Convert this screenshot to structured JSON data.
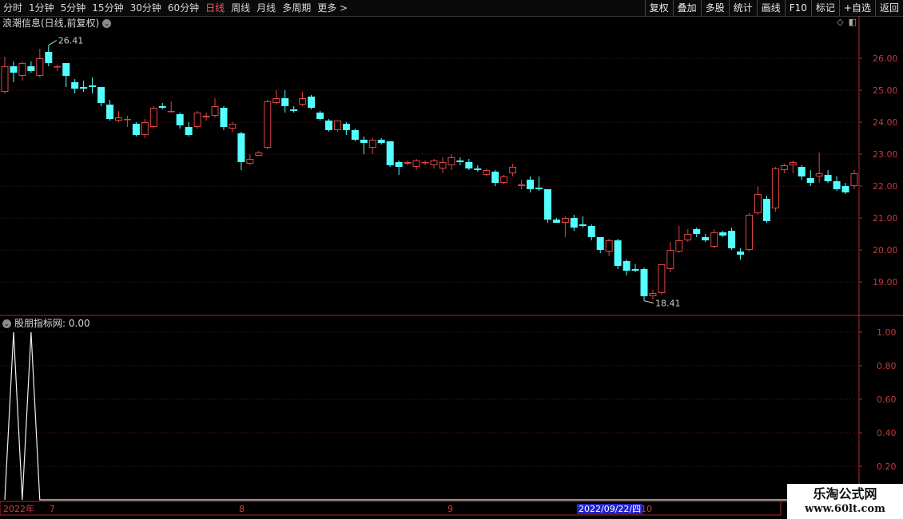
{
  "toolbar": {
    "tabs": [
      "分时",
      "1分钟",
      "5分钟",
      "15分钟",
      "30分钟",
      "60分钟",
      "日线",
      "周线",
      "月线",
      "多周期",
      "更多 >"
    ],
    "active_tab": "日线",
    "right_buttons": [
      "复权",
      "叠加",
      "多股",
      "统计",
      "画线",
      "F10",
      "标记",
      "+自选",
      "返回"
    ]
  },
  "main_panel": {
    "title": "浪潮信息(日线,前复权)",
    "max_label": "26.41",
    "min_label": "18.41",
    "price_ticks": [
      "26.00",
      "25.00",
      "24.00",
      "23.00",
      "22.00",
      "21.00",
      "20.00",
      "19.00"
    ],
    "up_color": "#e04545",
    "down_color": "#54ffff"
  },
  "indicator_panel": {
    "title": "股朋指标网",
    "value": ": 0.00",
    "ticks": [
      "1.00",
      "0.80",
      "0.60",
      "0.40",
      "0.20"
    ]
  },
  "date_axis": {
    "year_label": "2022年",
    "month_labels": [
      "7",
      "8",
      "9",
      "10"
    ],
    "cursor_date": "2022/09/22/四"
  },
  "watermark": {
    "line1": "乐淘公式网",
    "line2": "www.60lt.com"
  },
  "chart_data": {
    "type": "candlestick",
    "y_range": [
      18.0,
      26.9
    ],
    "candles": [
      [
        24.95,
        25.75,
        24.9,
        26.05
      ],
      [
        25.75,
        25.55,
        25.25,
        25.9
      ],
      [
        25.45,
        25.85,
        25.3,
        25.9
      ],
      [
        25.75,
        25.6,
        25.55,
        25.9
      ],
      [
        25.45,
        26.0,
        25.4,
        26.3
      ],
      [
        26.2,
        25.85,
        25.75,
        26.41
      ],
      [
        25.75,
        25.75,
        25.6,
        25.8
      ],
      [
        25.85,
        25.45,
        25.1,
        25.85
      ],
      [
        25.25,
        25.05,
        24.9,
        25.35
      ],
      [
        25.1,
        25.05,
        24.95,
        25.3
      ],
      [
        25.15,
        25.1,
        24.9,
        25.4
      ],
      [
        25.1,
        24.6,
        24.5,
        25.1
      ],
      [
        24.55,
        24.1,
        24.05,
        24.7
      ],
      [
        24.05,
        24.15,
        24.0,
        24.35
      ],
      [
        24.1,
        24.1,
        23.85,
        24.2
      ],
      [
        23.95,
        23.6,
        23.55,
        24.0
      ],
      [
        23.6,
        24.0,
        23.5,
        24.1
      ],
      [
        23.85,
        24.45,
        23.8,
        24.5
      ],
      [
        24.5,
        24.45,
        24.4,
        24.6
      ],
      [
        24.35,
        24.35,
        24.3,
        24.65
      ],
      [
        24.25,
        23.9,
        23.8,
        24.3
      ],
      [
        23.85,
        23.6,
        23.55,
        24.0
      ],
      [
        23.85,
        24.3,
        23.8,
        24.35
      ],
      [
        24.15,
        24.2,
        24.05,
        24.3
      ],
      [
        24.2,
        24.5,
        24.15,
        24.75
      ],
      [
        24.45,
        23.85,
        23.75,
        24.5
      ],
      [
        23.8,
        23.95,
        23.7,
        24.0
      ],
      [
        23.65,
        22.75,
        22.5,
        23.7
      ],
      [
        22.7,
        22.85,
        22.65,
        23.0
      ],
      [
        22.95,
        23.05,
        22.95,
        23.1
      ],
      [
        23.2,
        24.65,
        23.15,
        24.7
      ],
      [
        24.6,
        24.75,
        24.55,
        25.0
      ],
      [
        24.75,
        24.5,
        24.3,
        25.0
      ],
      [
        24.4,
        24.35,
        24.3,
        24.5
      ],
      [
        24.55,
        24.75,
        24.5,
        24.95
      ],
      [
        24.8,
        24.45,
        24.4,
        24.85
      ],
      [
        24.3,
        24.1,
        24.05,
        24.35
      ],
      [
        24.05,
        23.75,
        23.7,
        24.1
      ],
      [
        23.75,
        24.05,
        23.7,
        24.05
      ],
      [
        23.95,
        23.75,
        23.6,
        24.0
      ],
      [
        23.75,
        23.45,
        23.4,
        23.8
      ],
      [
        23.45,
        23.35,
        23.0,
        23.55
      ],
      [
        23.2,
        23.45,
        23.0,
        23.5
      ],
      [
        23.45,
        23.35,
        23.3,
        23.5
      ],
      [
        23.4,
        22.65,
        22.6,
        23.4
      ],
      [
        22.75,
        22.6,
        22.35,
        22.8
      ],
      [
        22.7,
        22.75,
        22.65,
        22.8
      ],
      [
        22.6,
        22.8,
        22.5,
        22.85
      ],
      [
        22.75,
        22.75,
        22.65,
        22.8
      ],
      [
        22.65,
        22.8,
        22.55,
        22.85
      ],
      [
        22.55,
        22.75,
        22.4,
        22.9
      ],
      [
        22.65,
        22.9,
        22.5,
        23.0
      ],
      [
        22.8,
        22.75,
        22.65,
        22.9
      ],
      [
        22.75,
        22.55,
        22.5,
        22.85
      ],
      [
        22.55,
        22.5,
        22.45,
        22.65
      ],
      [
        22.35,
        22.5,
        22.3,
        22.55
      ],
      [
        22.45,
        22.1,
        22.0,
        22.5
      ],
      [
        22.1,
        22.3,
        22.05,
        22.35
      ],
      [
        22.4,
        22.6,
        22.3,
        22.7
      ],
      [
        22.0,
        22.05,
        21.9,
        22.2
      ],
      [
        22.2,
        21.9,
        21.8,
        22.3
      ],
      [
        21.95,
        21.9,
        21.85,
        22.3
      ],
      [
        21.9,
        20.95,
        20.85,
        21.9
      ],
      [
        20.95,
        20.85,
        20.85,
        21.0
      ],
      [
        20.85,
        21.0,
        20.4,
        21.05
      ],
      [
        21.0,
        20.7,
        20.6,
        21.1
      ],
      [
        20.8,
        20.75,
        20.7,
        21.05
      ],
      [
        20.75,
        20.4,
        20.3,
        20.8
      ],
      [
        20.4,
        20.0,
        19.9,
        20.4
      ],
      [
        19.95,
        20.3,
        19.8,
        20.35
      ],
      [
        20.3,
        19.5,
        19.4,
        20.35
      ],
      [
        19.65,
        19.35,
        19.2,
        19.7
      ],
      [
        19.4,
        19.35,
        19.3,
        19.55
      ],
      [
        19.4,
        18.55,
        18.41,
        19.45
      ],
      [
        18.55,
        18.65,
        18.45,
        18.75
      ],
      [
        18.65,
        19.55,
        18.6,
        19.55
      ],
      [
        19.4,
        20.0,
        19.3,
        20.25
      ],
      [
        19.95,
        20.3,
        19.9,
        20.75
      ],
      [
        20.3,
        20.5,
        20.25,
        20.65
      ],
      [
        20.65,
        20.5,
        20.4,
        20.7
      ],
      [
        20.4,
        20.3,
        20.25,
        20.5
      ],
      [
        20.1,
        20.55,
        20.05,
        20.65
      ],
      [
        20.55,
        20.45,
        20.4,
        20.6
      ],
      [
        20.6,
        20.05,
        20.0,
        20.7
      ],
      [
        19.95,
        19.85,
        19.7,
        20.05
      ],
      [
        20.0,
        21.1,
        19.95,
        21.15
      ],
      [
        21.15,
        21.75,
        21.1,
        22.0
      ],
      [
        21.6,
        20.9,
        20.85,
        21.7
      ],
      [
        21.3,
        22.55,
        21.2,
        22.6
      ],
      [
        22.5,
        22.65,
        22.4,
        22.7
      ],
      [
        22.65,
        22.75,
        22.4,
        22.8
      ],
      [
        22.6,
        22.3,
        22.2,
        22.65
      ],
      [
        22.25,
        22.1,
        22.0,
        22.5
      ],
      [
        22.3,
        22.4,
        22.1,
        23.05
      ],
      [
        22.35,
        22.15,
        22.1,
        22.5
      ],
      [
        22.15,
        21.9,
        21.85,
        22.3
      ],
      [
        22.0,
        21.8,
        21.75,
        22.1
      ],
      [
        22.0,
        22.4,
        21.9,
        22.5
      ]
    ],
    "indicator_values": [
      0,
      1,
      0,
      1,
      0,
      0,
      0,
      0,
      0,
      0,
      0,
      0,
      0,
      0,
      0,
      0,
      0,
      0,
      0,
      0,
      0,
      0,
      0,
      0,
      0,
      0,
      0,
      0,
      0,
      0,
      0,
      0,
      0,
      0,
      0,
      0,
      0,
      0,
      0,
      0,
      0,
      0,
      0,
      0,
      0,
      0,
      0,
      0,
      0,
      0,
      0,
      0,
      0,
      0,
      0,
      0,
      0,
      0,
      0,
      0,
      0,
      0,
      0,
      0,
      0,
      0,
      0,
      0,
      0,
      0,
      0,
      0,
      0,
      0,
      0,
      0,
      0,
      0,
      0,
      0,
      0,
      0,
      0,
      0,
      0,
      0,
      0,
      0,
      0,
      0,
      0,
      0,
      0,
      0,
      0,
      0,
      0,
      0
    ]
  }
}
